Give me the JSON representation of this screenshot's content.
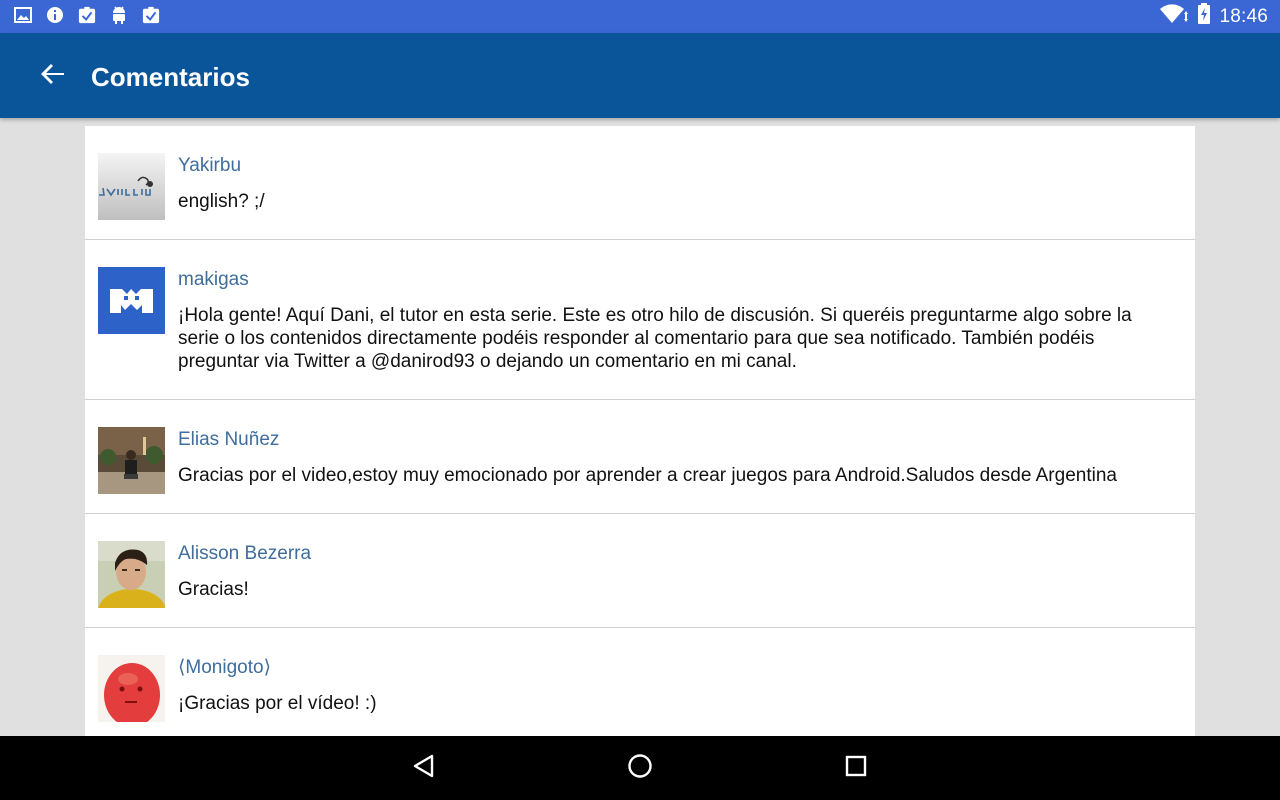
{
  "status_bar": {
    "left_icons": [
      "gallery-icon",
      "info-icon",
      "clipboard-check-icon",
      "android-icon",
      "clipboard-check-icon"
    ],
    "right_icons": [
      "wifi-icon",
      "battery-icon"
    ],
    "time": "18:46"
  },
  "app_bar": {
    "back_icon": "arrow-back-icon",
    "title": "Comentarios"
  },
  "comments": [
    {
      "author": "Yakirbu",
      "text": "english? ;/"
    },
    {
      "author": "makigas",
      "text": "¡Hola gente! Aquí Dani, el tutor en esta serie. Este es otro hilo de discusión. Si queréis preguntarme algo sobre la serie o los contenidos directamente podéis responder al comentario para que sea notificado. También podéis preguntar via Twitter a @danirod93 o dejando un comentario en mi canal."
    },
    {
      "author": "Elias Nuñez",
      "text": "Gracias por el video,estoy muy emocionado por aprender a crear juegos para Android.Saludos desde Argentina"
    },
    {
      "author": "Alisson Bezerra",
      "text": "Gracias!"
    },
    {
      "author": "⟨Monigoto⟩",
      "text": "¡Gracias por el vídeo! :)"
    }
  ],
  "nav_bar": {
    "buttons": [
      "back-triangle-icon",
      "home-circle-icon",
      "recents-square-icon"
    ]
  },
  "colors": {
    "status_bar": "#3a67d4",
    "app_bar": "#0a559a",
    "author_text": "#3f6d9c",
    "background": "#e0e0e0"
  }
}
